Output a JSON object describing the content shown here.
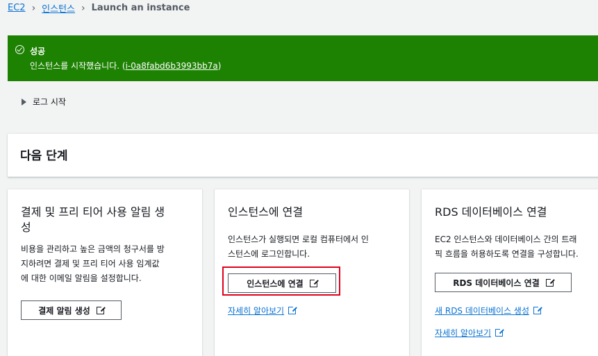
{
  "breadcrumb": {
    "root": "EC2",
    "section": "인스턴스",
    "current": "Launch an instance"
  },
  "flash": {
    "title": "성공",
    "message_prefix": "인스턴스를 시작했습니다. (",
    "instance_id": "i-0a8fabd6b3993bb7a",
    "message_suffix": ")"
  },
  "log": {
    "label": "로그 시작"
  },
  "next_steps": {
    "title": "다음 단계"
  },
  "cards": [
    {
      "title_line1": "결제 및 프리 티어 사용 알림 생",
      "title_line2": "성",
      "desc_line1": "비용을 관리하고 높은 금액의 청구서를 방",
      "desc_line2": "지하려면 결제 및 프리 티어 사용 임계값",
      "desc_line3": "에 대한 이메일 알림을 설정합니다.",
      "button": "결제 알림 생성"
    },
    {
      "title": "인스턴스에 연결",
      "desc_line1": "인스턴스가 실행되면 로컬 컴퓨터에서 인",
      "desc_line2": "스턴스에 로그인합니다.",
      "button": "인스턴스에 연결",
      "link": "자세히 알아보기"
    },
    {
      "title": "RDS 데이터베이스 연결",
      "desc_line1": "EC2 인스턴스와 데이터베이스 간의 트래",
      "desc_line2": "픽 흐름을 허용하도록 연결을 구성합니다.",
      "button": "RDS 데이터베이스 연결",
      "link1": "새 RDS 데이터베이스 생성",
      "link2": "자세히 알아보기"
    }
  ],
  "colors": {
    "success": "#1d8102",
    "link": "#0972d3",
    "highlight": "#e0001a"
  }
}
